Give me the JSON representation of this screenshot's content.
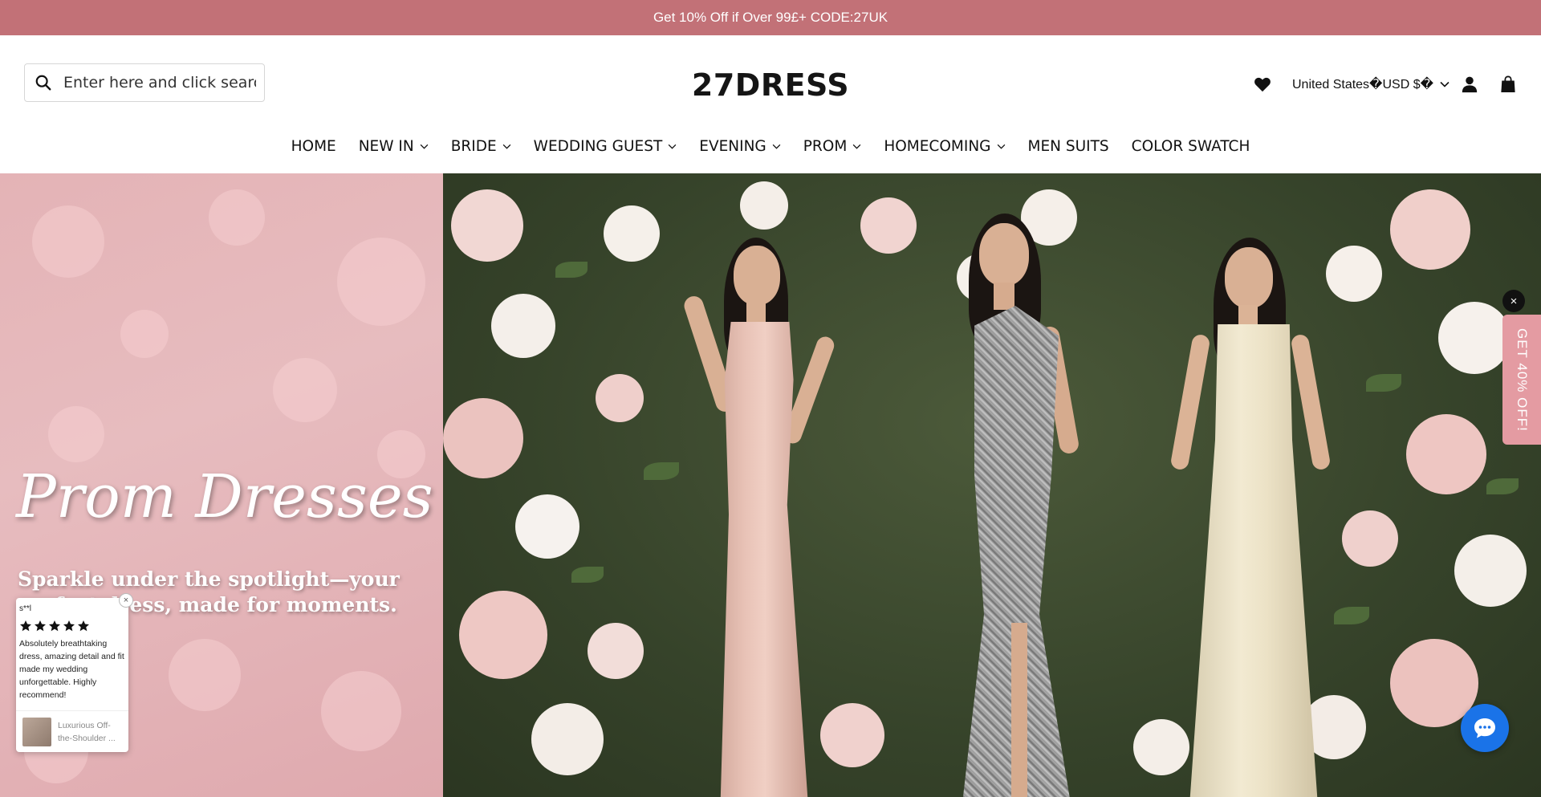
{
  "announcement": {
    "text": "Get 10% Off if Over 99£+ CODE:27UK"
  },
  "header": {
    "search_placeholder": "Enter here and click search",
    "logo": "27DRESS",
    "currency_label": "United States�USD $�"
  },
  "icons": {
    "search": "search-icon",
    "wishlist": "heart-icon",
    "account": "user-icon",
    "cart": "shopping-bag-icon",
    "chat": "chat-icon"
  },
  "nav": [
    {
      "label": "HOME",
      "dropdown": false
    },
    {
      "label": "NEW IN",
      "dropdown": true
    },
    {
      "label": "BRIDE",
      "dropdown": true
    },
    {
      "label": "WEDDING GUEST",
      "dropdown": true
    },
    {
      "label": "EVENING",
      "dropdown": true
    },
    {
      "label": "PROM",
      "dropdown": true
    },
    {
      "label": "HOMECOMING",
      "dropdown": true
    },
    {
      "label": "MEN SUITS",
      "dropdown": false
    },
    {
      "label": "COLOR SWATCH",
      "dropdown": false
    }
  ],
  "hero": {
    "title": "Prom Dresses",
    "subtitle": "Sparkle under the spotlight—your perfect dress, made for moments."
  },
  "review": {
    "name": "s**l",
    "rating": 5,
    "text": "Absolutely breathtaking dress, amazing detail and fit made my wedding unforgettable. Highly recommend!",
    "product": "Luxurious Off-the-Shoulder ...",
    "close": "×"
  },
  "side_tab": {
    "label": "GET 40% OFF!",
    "close": "×"
  },
  "colors": {
    "announcement_bg": "#c27177",
    "side_tab_bg": "#e49ba2",
    "chat_bg": "#1a73e8"
  }
}
